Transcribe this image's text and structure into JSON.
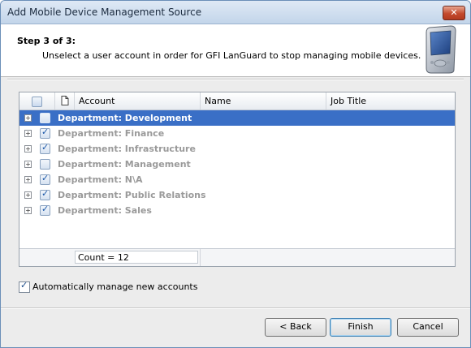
{
  "window": {
    "title": "Add Mobile Device Management Source",
    "close_glyph": "✕"
  },
  "header": {
    "step": "Step 3 of 3:",
    "instruction": "Unselect a user account in order for GFI LanGuard to stop managing mobile devices.",
    "icon": "mobile-device-icon"
  },
  "grid": {
    "columns": [
      "Account",
      "Name",
      "Job Title"
    ],
    "rows": [
      {
        "label": "Department: Development",
        "checked": false,
        "selected": true
      },
      {
        "label": "Department: Finance",
        "checked": true
      },
      {
        "label": "Department: Infrastructure",
        "checked": true
      },
      {
        "label": "Department: Management",
        "checked": false
      },
      {
        "label": "Department: N\\A",
        "checked": true
      },
      {
        "label": "Department: Public Relations",
        "checked": true
      },
      {
        "label": "Department: Sales",
        "checked": true
      }
    ],
    "footer_count": "Count = 12"
  },
  "auto_manage": {
    "label": "Automatically manage new accounts",
    "checked": true
  },
  "buttons": {
    "back": "< Back",
    "finish": "Finish",
    "cancel": "Cancel"
  }
}
